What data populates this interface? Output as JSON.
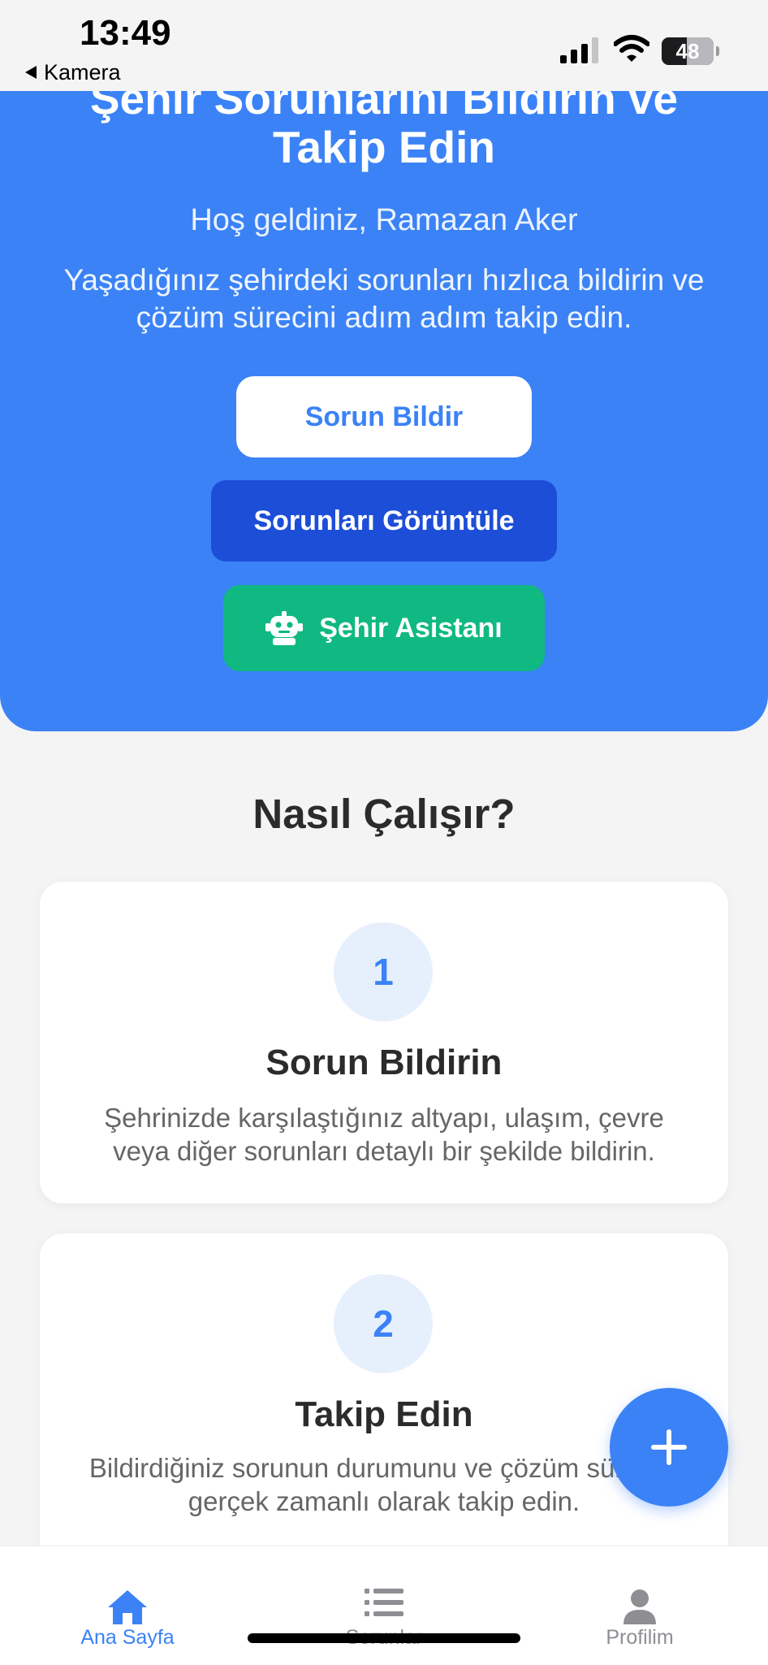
{
  "status_bar": {
    "time": "13:49",
    "back_label": "Kamera",
    "battery_level": "48",
    "battery_fraction": 0.48
  },
  "hero": {
    "title_line1": "Şehir Sorunlarını Bildirin ve",
    "title_line2": "Takip Edin",
    "welcome": "Hoş geldiniz, Ramazan Aker",
    "description": "Yaşadığınız şehirdeki sorunları hızlıca bildirin ve çözüm sürecini adım adım takip edin.",
    "report_button": "Sorun Bildir",
    "view_button": "Sorunları Görüntüle",
    "assistant_button": "Şehir Asistanı",
    "assistant_icon": "robot-icon"
  },
  "how_it_works": {
    "title": "Nasıl Çalışır?",
    "steps": [
      {
        "number": "1",
        "title": "Sorun Bildirin",
        "description": "Şehrinizde karşılaştığınız altyapı, ulaşım, çevre veya diğer sorunları detaylı bir şekilde bildirin."
      },
      {
        "number": "2",
        "title": "Takip Edin",
        "description": "Bildirdiğiniz sorunun durumunu ve çözüm sürecini gerçek zamanlı olarak takip edin."
      }
    ]
  },
  "fab": {
    "icon": "plus-icon"
  },
  "tab_bar": {
    "tabs": [
      {
        "label": "Ana Sayfa",
        "icon": "home-icon",
        "active": true
      },
      {
        "label": "Sorunlar",
        "icon": "list-icon",
        "active": false
      },
      {
        "label": "Profilim",
        "icon": "user-icon",
        "active": false
      }
    ]
  },
  "colors": {
    "primary": "#3b82f6",
    "primary_dark": "#1d4ed8",
    "green": "#10b981",
    "background": "#f4f4f5",
    "inactive_tab": "#8e8e93"
  }
}
